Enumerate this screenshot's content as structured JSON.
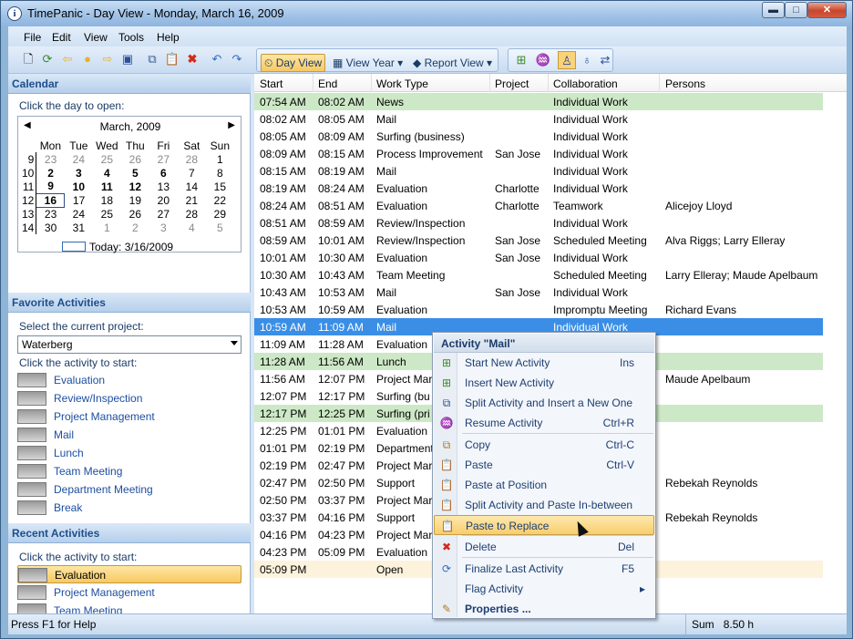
{
  "window": {
    "title": "TimePanic - Day View - Monday, March 16, 2009",
    "icon": "clock-info-icon"
  },
  "menubar": [
    "File",
    "Edit",
    "View",
    "Tools",
    "Help"
  ],
  "toolbar": {
    "day_view": "Day View",
    "view_year": "View Year",
    "report_view": "Report View"
  },
  "calendar": {
    "header": "Calendar",
    "hint": "Click the day to open:",
    "month": "March, 2009",
    "weekdays": [
      "Mon",
      "Tue",
      "Wed",
      "Thu",
      "Fri",
      "Sat",
      "Sun"
    ],
    "weeks": [
      {
        "wk": "9",
        "days": [
          "23",
          "24",
          "25",
          "26",
          "27",
          "28",
          "1"
        ]
      },
      {
        "wk": "10",
        "days": [
          "2",
          "3",
          "4",
          "5",
          "6",
          "7",
          "8"
        ]
      },
      {
        "wk": "11",
        "days": [
          "9",
          "10",
          "11",
          "12",
          "13",
          "14",
          "15"
        ]
      },
      {
        "wk": "12",
        "days": [
          "16",
          "17",
          "18",
          "19",
          "20",
          "21",
          "22"
        ]
      },
      {
        "wk": "13",
        "days": [
          "23",
          "24",
          "25",
          "26",
          "27",
          "28",
          "29"
        ]
      },
      {
        "wk": "14",
        "days": [
          "30",
          "31",
          "1",
          "2",
          "3",
          "4",
          "5"
        ]
      }
    ],
    "today": "Today: 3/16/2009"
  },
  "favorites": {
    "header": "Favorite Activities",
    "project_hint": "Select the current project:",
    "project": "Waterberg",
    "activity_hint": "Click the activity to start:",
    "items": [
      "Evaluation",
      "Review/Inspection",
      "Project Management",
      "Mail",
      "Lunch",
      "Team Meeting",
      "Department Meeting",
      "Break"
    ]
  },
  "recent": {
    "header": "Recent Activities",
    "hint": "Click the activity to start:",
    "items": [
      "Evaluation",
      "Project Management",
      "Team Meeting"
    ]
  },
  "grid": {
    "columns": [
      "Start",
      "End",
      "Work Type",
      "Project",
      "Collaboration",
      "Persons"
    ],
    "rows": [
      {
        "start": "07:54 AM",
        "end": "08:02 AM",
        "type": "News",
        "project": "",
        "collab": "Individual Work",
        "persons": ""
      },
      {
        "start": "08:02 AM",
        "end": "08:05 AM",
        "type": "Mail",
        "project": "",
        "collab": "Individual Work",
        "persons": ""
      },
      {
        "start": "08:05 AM",
        "end": "08:09 AM",
        "type": "Surfing (business)",
        "project": "",
        "collab": "Individual Work",
        "persons": ""
      },
      {
        "start": "08:09 AM",
        "end": "08:15 AM",
        "type": "Process Improvement",
        "project": "San Jose",
        "collab": "Individual Work",
        "persons": ""
      },
      {
        "start": "08:15 AM",
        "end": "08:19 AM",
        "type": "Mail",
        "project": "",
        "collab": "Individual Work",
        "persons": ""
      },
      {
        "start": "08:19 AM",
        "end": "08:24 AM",
        "type": "Evaluation",
        "project": "Charlotte",
        "collab": "Individual Work",
        "persons": ""
      },
      {
        "start": "08:24 AM",
        "end": "08:51 AM",
        "type": "Evaluation",
        "project": "Charlotte",
        "collab": "Teamwork",
        "persons": "Alicejoy Lloyd"
      },
      {
        "start": "08:51 AM",
        "end": "08:59 AM",
        "type": "Review/Inspection",
        "project": "",
        "collab": "Individual Work",
        "persons": ""
      },
      {
        "start": "08:59 AM",
        "end": "10:01 AM",
        "type": "Review/Inspection",
        "project": "San Jose",
        "collab": "Scheduled Meeting",
        "persons": "Alva Riggs; Larry Elleray"
      },
      {
        "start": "10:01 AM",
        "end": "10:30 AM",
        "type": "Evaluation",
        "project": "San Jose",
        "collab": "Individual Work",
        "persons": ""
      },
      {
        "start": "10:30 AM",
        "end": "10:43 AM",
        "type": "Team Meeting",
        "project": "",
        "collab": "Scheduled Meeting",
        "persons": "Larry Elleray; Maude Apelbaum"
      },
      {
        "start": "10:43 AM",
        "end": "10:53 AM",
        "type": "Mail",
        "project": "San Jose",
        "collab": "Individual Work",
        "persons": ""
      },
      {
        "start": "10:53 AM",
        "end": "10:59 AM",
        "type": "Evaluation",
        "project": "",
        "collab": "Impromptu Meeting",
        "persons": "Richard Evans"
      },
      {
        "start": "10:59 AM",
        "end": "11:09 AM",
        "type": "Mail",
        "project": "",
        "collab": "Individual Work",
        "persons": ""
      },
      {
        "start": "11:09 AM",
        "end": "11:28 AM",
        "type": "Evaluation",
        "project": "",
        "collab": "",
        "persons": ""
      },
      {
        "start": "11:28 AM",
        "end": "11:56 AM",
        "type": "Lunch",
        "project": "",
        "collab": "",
        "persons": ""
      },
      {
        "start": "11:56 AM",
        "end": "12:07 PM",
        "type": "Project Mar",
        "project": "",
        "collab": "",
        "persons": "Maude Apelbaum"
      },
      {
        "start": "12:07 PM",
        "end": "12:17 PM",
        "type": "Surfing (bu",
        "project": "",
        "collab": "",
        "persons": ""
      },
      {
        "start": "12:17 PM",
        "end": "12:25 PM",
        "type": "Surfing (pri",
        "project": "",
        "collab": "",
        "persons": ""
      },
      {
        "start": "12:25 PM",
        "end": "01:01 PM",
        "type": "Evaluation",
        "project": "",
        "collab": "",
        "persons": ""
      },
      {
        "start": "01:01 PM",
        "end": "02:19 PM",
        "type": "Department",
        "project": "",
        "collab": "",
        "persons": ""
      },
      {
        "start": "02:19 PM",
        "end": "02:47 PM",
        "type": "Project Mar",
        "project": "",
        "collab": "",
        "persons": ""
      },
      {
        "start": "02:47 PM",
        "end": "02:50 PM",
        "type": "Support",
        "project": "",
        "collab": "",
        "persons": "Rebekah Reynolds"
      },
      {
        "start": "02:50 PM",
        "end": "03:37 PM",
        "type": "Project Mar",
        "project": "",
        "collab": "",
        "persons": ""
      },
      {
        "start": "03:37 PM",
        "end": "04:16 PM",
        "type": "Support",
        "project": "",
        "collab": "",
        "persons": "Rebekah Reynolds"
      },
      {
        "start": "04:16 PM",
        "end": "04:23 PM",
        "type": "Project Mar",
        "project": "",
        "collab": "",
        "persons": ""
      },
      {
        "start": "04:23 PM",
        "end": "05:09 PM",
        "type": "Evaluation",
        "project": "",
        "collab": "",
        "persons": ""
      },
      {
        "start": "05:09 PM",
        "end": "",
        "type": "Open",
        "project": "",
        "collab": "",
        "persons": ""
      }
    ],
    "row_styles": [
      "green",
      "",
      "",
      "",
      "",
      "",
      "",
      "",
      "",
      "",
      "",
      "",
      "",
      "sel",
      "",
      "green",
      "",
      "",
      "green",
      "",
      "",
      "",
      "",
      "",
      "",
      "",
      "",
      "open"
    ]
  },
  "context_menu": {
    "title": "Activity \"Mail\"",
    "items": [
      {
        "label": "Start New Activity",
        "key": "Ins",
        "icon": "start-activity-icon"
      },
      {
        "label": "Insert New Activity",
        "key": "",
        "icon": "insert-activity-icon"
      },
      {
        "label": "Split Activity and Insert a New One",
        "key": "",
        "icon": "split-insert-icon"
      },
      {
        "label": "Resume Activity",
        "key": "Ctrl+R",
        "icon": "resume-icon"
      },
      {
        "label": "Copy",
        "key": "Ctrl-C",
        "icon": "copy-icon"
      },
      {
        "label": "Paste",
        "key": "Ctrl-V",
        "icon": "paste-icon"
      },
      {
        "label": "Paste at Position",
        "key": "",
        "icon": "paste-position-icon"
      },
      {
        "label": "Split Activity and Paste In-between",
        "key": "",
        "icon": "split-paste-icon"
      },
      {
        "label": "Paste to Replace",
        "key": "",
        "icon": "paste-replace-icon"
      },
      {
        "label": "Delete",
        "key": "Del",
        "icon": "delete-icon"
      },
      {
        "label": "Finalize Last Activity",
        "key": "F5",
        "icon": "finalize-icon"
      },
      {
        "label": "Flag Activity",
        "key": "",
        "icon": "flag-icon"
      },
      {
        "label": "Properties ...",
        "key": "",
        "icon": "properties-icon"
      }
    ]
  },
  "status": {
    "left": "Press F1 for Help",
    "sum_label": "Sum",
    "sum_value": "8.50 h"
  }
}
